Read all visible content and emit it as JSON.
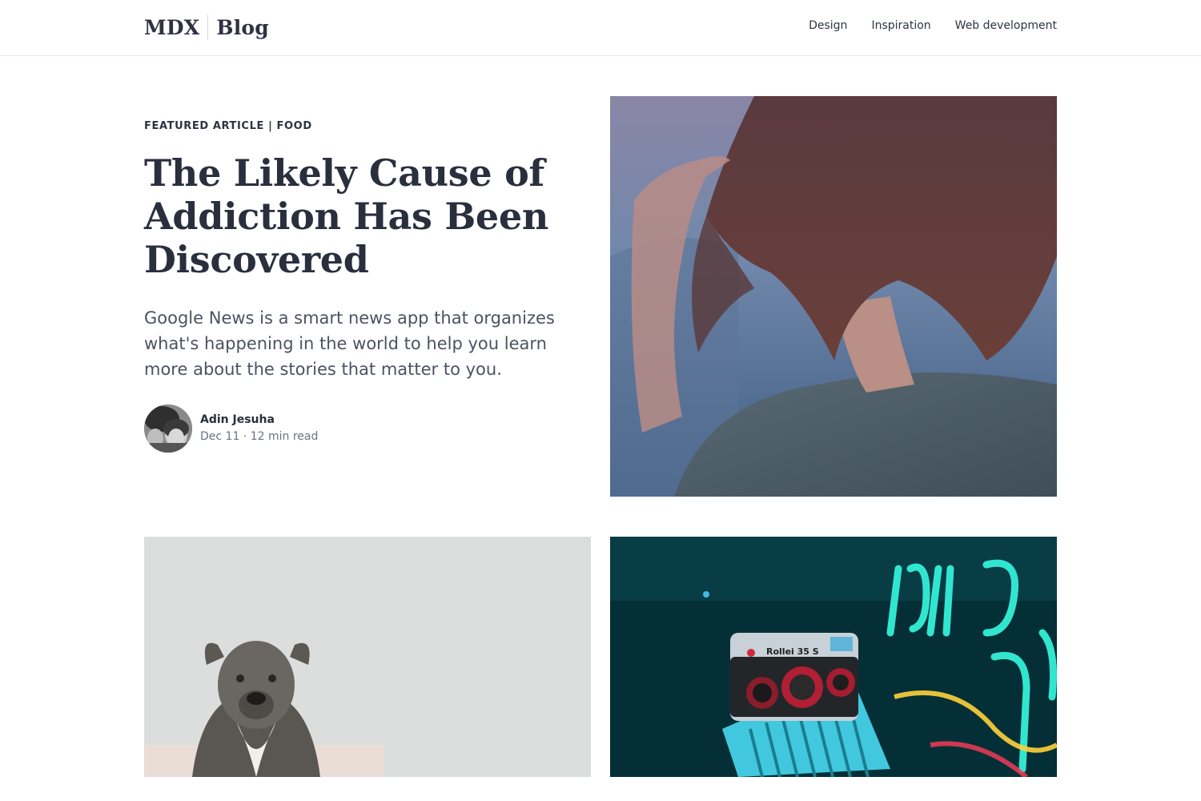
{
  "header": {
    "brand_left": "MDX",
    "brand_right": "Blog",
    "nav": [
      "Design",
      "Inspiration",
      "Web development"
    ]
  },
  "featured": {
    "eyebrow": "FEATURED ARTICLE | FOOD",
    "title": "The Likely Cause of Addiction Has Been Discovered",
    "summary": "Google News is a smart news app that organizes what's happening in the world to help you learn more about the stories that matter to you.",
    "author": {
      "name": "Adin Jesuha",
      "meta": "Dec 11 · 12 min read"
    }
  },
  "images": {
    "camera_label": "Rollei 35 S"
  },
  "colors": {
    "text": "#2a2f3e",
    "muted": "#6b7180",
    "border": "#e6e8ec"
  }
}
